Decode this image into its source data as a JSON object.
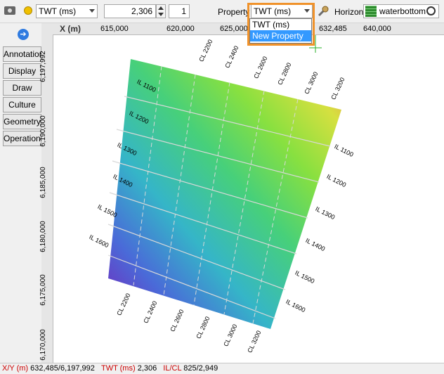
{
  "toolbar": {
    "attribute_combo": "TWT (ms)",
    "value_field": "2,306",
    "step_field": "1",
    "property_label": "Property",
    "property_combo": "TWT (ms)",
    "horizon_label": "Horizon",
    "horizon_value": "waterbottom"
  },
  "dropdown": {
    "options": [
      "TWT (ms)",
      "New Property"
    ],
    "selected": "New Property"
  },
  "tabs": [
    "Annotation",
    "Display",
    "Draw",
    "Culture",
    "Geometry",
    "Operations"
  ],
  "map": {
    "x_axis_label": "X (m)",
    "x_ticks": [
      "615,000",
      "620,000",
      "625,000",
      "632,485",
      "640,000"
    ],
    "y_ticks": [
      "6,197,992",
      "6,190,000",
      "6,185,000",
      "6,180,000",
      "6,175,000",
      "6,170,000"
    ],
    "il_left": [
      "IL 1100",
      "IL 1200",
      "IL 1300",
      "IL 1400",
      "IL 1500",
      "IL 1600"
    ],
    "il_right": [
      "IL 1100",
      "IL 1200",
      "IL 1300",
      "IL 1400",
      "IL 1500",
      "IL 1600"
    ],
    "cl_top": [
      "CL 2200",
      "CL 2400",
      "CL 2600",
      "CL 2800",
      "CL 3000",
      "CL 3200"
    ],
    "cl_bottom": [
      "CL 2200",
      "CL 2400",
      "CL 2600",
      "CL 2800",
      "CL 3000",
      "CL 3200"
    ]
  },
  "status": {
    "xy_label": "X/Y (m)",
    "xy_value": "632,485/6,197,992",
    "twt_label": "TWT (ms)",
    "twt_value": "2,306",
    "ilcl_label": "IL/CL",
    "ilcl_value": "825/2,949"
  },
  "colors": {
    "accent_label": "#cc0000",
    "highlight": "#f0922a",
    "selection": "#3399ff"
  }
}
